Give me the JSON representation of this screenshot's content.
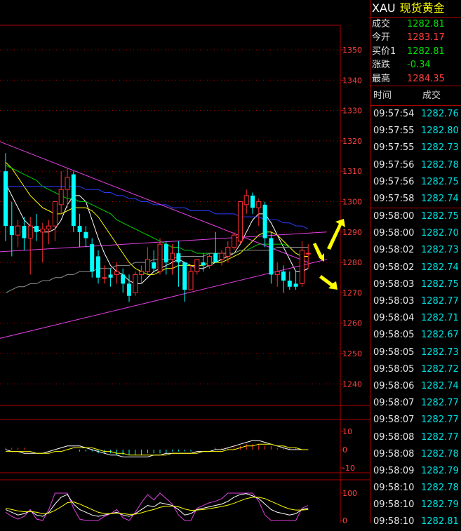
{
  "header": {
    "symbol": "XAU",
    "name": "现货黄金"
  },
  "quote": [
    {
      "label": "成交",
      "value": "1282.81",
      "color": "down"
    },
    {
      "label": "今开",
      "value": "1283.17",
      "color": "up"
    },
    {
      "label": "买价1",
      "value": "1282.81",
      "color": "down"
    },
    {
      "label": "涨跌",
      "value": "-0.34",
      "color": "down"
    },
    {
      "label": "最高",
      "value": "1284.35",
      "color": "up"
    }
  ],
  "ticks_header": {
    "time": "时间",
    "price": "成交"
  },
  "ticks_group1": [
    {
      "time": "09:57:54",
      "price": "1282.76"
    },
    {
      "time": "09:57:55",
      "price": "1282.80"
    },
    {
      "time": "09:57:55",
      "price": "1282.73"
    },
    {
      "time": "09:57:56",
      "price": "1282.78"
    },
    {
      "time": "09:57:56",
      "price": "1282.75"
    },
    {
      "time": "09:57:58",
      "price": "1282.74"
    }
  ],
  "ticks_group2": [
    {
      "time": "09:58:00",
      "price": "1282.75"
    },
    {
      "time": "09:58:00",
      "price": "1282.70"
    },
    {
      "time": "09:58:02",
      "price": "1282.73"
    },
    {
      "time": "09:58:02",
      "price": "1282.74"
    },
    {
      "time": "09:58:03",
      "price": "1282.75"
    },
    {
      "time": "09:58:03",
      "price": "1282.77"
    },
    {
      "time": "09:58:04",
      "price": "1282.71"
    },
    {
      "time": "09:58:05",
      "price": "1282.67"
    },
    {
      "time": "09:58:05",
      "price": "1282.73"
    },
    {
      "time": "09:58:05",
      "price": "1282.72"
    },
    {
      "time": "09:58:06",
      "price": "1282.74"
    },
    {
      "time": "09:58:07",
      "price": "1282.77"
    },
    {
      "time": "09:58:07",
      "price": "1282.77"
    },
    {
      "time": "09:58:08",
      "price": "1282.77"
    },
    {
      "time": "09:58:08",
      "price": "1282.78"
    },
    {
      "time": "09:58:09",
      "price": "1282.79"
    },
    {
      "time": "09:58:10",
      "price": "1282.78"
    },
    {
      "time": "09:58:10",
      "price": "1282.79"
    },
    {
      "time": "09:58:10",
      "price": "1282.81"
    }
  ],
  "colors": {
    "up": "#ff3030",
    "down": "#00ffff",
    "border": "#b00000",
    "axis_text": "#ff4040"
  },
  "chart_data": {
    "type": "candlestick",
    "price_axis": {
      "ylim": [
        1230,
        1360
      ],
      "ticks": [
        1350,
        1340,
        1330,
        1320,
        1310,
        1300,
        1290,
        1280,
        1270,
        1260,
        1250,
        1240
      ]
    },
    "macd_axis": {
      "ticks": [
        10,
        0,
        -10
      ]
    },
    "kdj_axis": {
      "ticks": [
        100,
        0
      ]
    },
    "candles": [
      {
        "o": 1310,
        "h": 1316,
        "l": 1287,
        "c": 1292
      },
      {
        "o": 1292,
        "h": 1300,
        "l": 1282,
        "c": 1289
      },
      {
        "o": 1289,
        "h": 1294,
        "l": 1285,
        "c": 1292
      },
      {
        "o": 1292,
        "h": 1295,
        "l": 1284,
        "c": 1288
      },
      {
        "o": 1288,
        "h": 1295,
        "l": 1276,
        "c": 1292
      },
      {
        "o": 1292,
        "h": 1296,
        "l": 1287,
        "c": 1290
      },
      {
        "o": 1290,
        "h": 1293,
        "l": 1280,
        "c": 1291
      },
      {
        "o": 1291,
        "h": 1294,
        "l": 1286,
        "c": 1292
      },
      {
        "o": 1292,
        "h": 1300,
        "l": 1287,
        "c": 1300
      },
      {
        "o": 1299,
        "h": 1310,
        "l": 1296,
        "c": 1304
      },
      {
        "o": 1304,
        "h": 1311,
        "l": 1298,
        "c": 1308
      },
      {
        "o": 1309,
        "h": 1310,
        "l": 1290,
        "c": 1292
      },
      {
        "o": 1292,
        "h": 1296,
        "l": 1285,
        "c": 1290
      },
      {
        "o": 1290,
        "h": 1292,
        "l": 1285,
        "c": 1288
      },
      {
        "o": 1286,
        "h": 1288,
        "l": 1275,
        "c": 1277
      },
      {
        "o": 1282,
        "h": 1284,
        "l": 1273,
        "c": 1275
      },
      {
        "o": 1275,
        "h": 1279,
        "l": 1273,
        "c": 1275
      },
      {
        "o": 1276,
        "h": 1278,
        "l": 1272,
        "c": 1275
      },
      {
        "o": 1276,
        "h": 1280,
        "l": 1273,
        "c": 1277
      },
      {
        "o": 1276,
        "h": 1278,
        "l": 1270,
        "c": 1273
      },
      {
        "o": 1273,
        "h": 1276,
        "l": 1267,
        "c": 1269
      },
      {
        "o": 1270,
        "h": 1277,
        "l": 1269,
        "c": 1276
      },
      {
        "o": 1276,
        "h": 1279,
        "l": 1273,
        "c": 1277
      },
      {
        "o": 1277,
        "h": 1285,
        "l": 1276,
        "c": 1281
      },
      {
        "o": 1280,
        "h": 1284,
        "l": 1277,
        "c": 1278
      },
      {
        "o": 1277,
        "h": 1288,
        "l": 1276,
        "c": 1286
      },
      {
        "o": 1286,
        "h": 1287,
        "l": 1276,
        "c": 1280
      },
      {
        "o": 1281,
        "h": 1286,
        "l": 1276,
        "c": 1283
      },
      {
        "o": 1283,
        "h": 1287,
        "l": 1272,
        "c": 1280
      },
      {
        "o": 1280,
        "h": 1280,
        "l": 1267,
        "c": 1271
      },
      {
        "o": 1271,
        "h": 1279,
        "l": 1271,
        "c": 1277
      },
      {
        "o": 1277,
        "h": 1281,
        "l": 1276,
        "c": 1281
      },
      {
        "o": 1280,
        "h": 1283,
        "l": 1277,
        "c": 1279
      },
      {
        "o": 1279,
        "h": 1283,
        "l": 1278,
        "c": 1282
      },
      {
        "o": 1283,
        "h": 1290,
        "l": 1280,
        "c": 1280
      },
      {
        "o": 1281,
        "h": 1284,
        "l": 1279,
        "c": 1283
      },
      {
        "o": 1282,
        "h": 1287,
        "l": 1280,
        "c": 1285
      },
      {
        "o": 1285,
        "h": 1290,
        "l": 1284,
        "c": 1289
      },
      {
        "o": 1287,
        "h": 1300,
        "l": 1286,
        "c": 1300
      },
      {
        "o": 1299,
        "h": 1304,
        "l": 1296,
        "c": 1302
      },
      {
        "o": 1302,
        "h": 1303,
        "l": 1296,
        "c": 1298
      },
      {
        "o": 1298,
        "h": 1301,
        "l": 1292,
        "c": 1300
      },
      {
        "o": 1299,
        "h": 1300,
        "l": 1285,
        "c": 1288
      },
      {
        "o": 1288,
        "h": 1290,
        "l": 1273,
        "c": 1276
      },
      {
        "o": 1276,
        "h": 1280,
        "l": 1272,
        "c": 1277
      },
      {
        "o": 1277,
        "h": 1279,
        "l": 1270,
        "c": 1274
      },
      {
        "o": 1274,
        "h": 1277,
        "l": 1271,
        "c": 1272
      },
      {
        "o": 1273,
        "h": 1277,
        "l": 1271,
        "c": 1272
      },
      {
        "o": 1273,
        "h": 1287,
        "l": 1272,
        "c": 1284
      },
      {
        "o": 1283,
        "h": 1286,
        "l": 1278,
        "c": 1283
      }
    ],
    "moving_averages": [
      {
        "color": "#ffffff",
        "values": [
          1306,
          1302,
          1298,
          1294,
          1292,
          1291,
          1290,
          1290,
          1291,
          1294,
          1299,
          1302,
          1302,
          1300,
          1294,
          1288,
          1283,
          1279,
          1277,
          1276,
          1274,
          1273,
          1273,
          1275,
          1277,
          1278,
          1279,
          1280,
          1281,
          1280,
          1279,
          1278,
          1278,
          1279,
          1280,
          1281,
          1282,
          1283,
          1286,
          1290,
          1294,
          1296,
          1296,
          1293,
          1289,
          1285,
          1281,
          1277,
          1277,
          1278
        ]
      },
      {
        "color": "#ffff00",
        "values": [
          1313,
          1311,
          1308,
          1305,
          1302,
          1300,
          1298,
          1297,
          1296,
          1296,
          1297,
          1298,
          1298,
          1298,
          1297,
          1295,
          1292,
          1289,
          1286,
          1283,
          1280,
          1278,
          1277,
          1276,
          1276,
          1277,
          1278,
          1278,
          1279,
          1279,
          1279,
          1279,
          1279,
          1280,
          1280,
          1280,
          1281,
          1282,
          1283,
          1285,
          1287,
          1289,
          1290,
          1290,
          1289,
          1287,
          1285,
          1283,
          1282,
          1282
        ]
      },
      {
        "color": "#00d000",
        "values": [
          1312,
          1311,
          1310,
          1309,
          1308,
          1307,
          1305,
          1304,
          1303,
          1302,
          1301,
          1301,
          1300,
          1300,
          1299,
          1298,
          1297,
          1296,
          1294,
          1293,
          1292,
          1291,
          1290,
          1289,
          1288,
          1287,
          1286,
          1285,
          1285,
          1284,
          1284,
          1283,
          1283,
          1283,
          1283,
          1283,
          1283,
          1283,
          1284,
          1284,
          1285,
          1286,
          1286,
          1286,
          1286,
          1286,
          1285,
          1285,
          1285,
          1285
        ]
      },
      {
        "color": "#2a3cff",
        "values": [
          1305,
          1305,
          1305,
          1305,
          1305,
          1305,
          1305,
          1305,
          1305,
          1305,
          1305,
          1305,
          1305,
          1304,
          1304,
          1304,
          1303,
          1303,
          1302,
          1302,
          1301,
          1301,
          1300,
          1300,
          1299,
          1299,
          1299,
          1298,
          1298,
          1298,
          1297,
          1297,
          1297,
          1297,
          1296,
          1296,
          1296,
          1296,
          1295,
          1295,
          1295,
          1295,
          1294,
          1294,
          1294,
          1293,
          1293,
          1292,
          1292,
          1291
        ]
      },
      {
        "color": "#909090",
        "values": [
          1270,
          1271,
          1272,
          1272,
          1273,
          1273,
          1274,
          1274,
          1275,
          1275,
          1276,
          1276,
          1277,
          1277,
          1277,
          1278,
          1278,
          1278,
          1279,
          1279,
          1279,
          1280,
          1280,
          1280,
          1281,
          1281,
          1281,
          1281,
          1282,
          1282,
          1282,
          1282,
          1282,
          1283,
          1283,
          1283,
          1283,
          1283,
          1284,
          1284,
          1284,
          1284,
          1284,
          1284,
          1285,
          1285,
          1285,
          1285,
          1285,
          1285
        ]
      }
    ],
    "trend_lines": [
      {
        "from": [
          -5,
          1323
        ],
        "to": [
          49,
          1280
        ]
      },
      {
        "from": [
          -5,
          1253
        ],
        "to": [
          52,
          1281
        ]
      },
      {
        "from": [
          -5,
          1283
        ],
        "to": [
          52,
          1290
        ]
      }
    ],
    "macd_values": [
      1,
      1,
      1,
      1,
      0,
      0,
      0,
      0,
      0,
      0,
      0,
      0,
      -1,
      -1,
      -1,
      -2,
      -2,
      -2,
      -3,
      -3,
      -3,
      -3,
      -3,
      -2,
      -2,
      -2,
      -2,
      -1,
      -1,
      -1,
      -1,
      0,
      0,
      0,
      1,
      1,
      1,
      2,
      2,
      3,
      3,
      3,
      2,
      2,
      1,
      1,
      1,
      1,
      0,
      0
    ],
    "macd_line_a": [
      0,
      -1,
      -1,
      -2,
      -2,
      -2,
      -2,
      -1,
      0,
      1,
      2,
      2,
      2,
      1,
      0,
      -1,
      -2,
      -3,
      -3,
      -4,
      -4,
      -4,
      -4,
      -4,
      -3,
      -3,
      -2,
      -2,
      -2,
      -2,
      -2,
      -1,
      -1,
      -1,
      0,
      0,
      1,
      2,
      3,
      4,
      5,
      5,
      4,
      3,
      2,
      1,
      0,
      0,
      0,
      0
    ],
    "macd_line_b": [
      -1,
      -1,
      -1,
      -1,
      -1,
      -2,
      -2,
      -2,
      -1,
      -1,
      0,
      1,
      1,
      1,
      1,
      0,
      -1,
      -1,
      -2,
      -2,
      -3,
      -3,
      -3,
      -3,
      -3,
      -3,
      -3,
      -2,
      -2,
      -2,
      -2,
      -2,
      -1,
      -1,
      -1,
      -1,
      0,
      0,
      1,
      2,
      2,
      3,
      3,
      3,
      2,
      2,
      1,
      1,
      0,
      0
    ],
    "kdj_k": [
      40,
      30,
      20,
      25,
      35,
      20,
      15,
      30,
      60,
      85,
      95,
      60,
      40,
      30,
      20,
      15,
      20,
      25,
      30,
      20,
      15,
      25,
      40,
      55,
      50,
      65,
      60,
      55,
      40,
      20,
      25,
      40,
      45,
      50,
      55,
      60,
      70,
      85,
      95,
      98,
      90,
      80,
      60,
      40,
      30,
      25,
      20,
      25,
      40,
      45
    ],
    "kdj_d": [
      45,
      40,
      35,
      32,
      33,
      30,
      25,
      27,
      37,
      50,
      65,
      68,
      60,
      50,
      40,
      30,
      25,
      25,
      27,
      25,
      22,
      23,
      28,
      35,
      40,
      48,
      52,
      53,
      50,
      42,
      37,
      38,
      40,
      43,
      47,
      51,
      56,
      63,
      72,
      80,
      85,
      85,
      80,
      70,
      60,
      50,
      42,
      38,
      38,
      40
    ],
    "kdj_j": [
      30,
      15,
      5,
      15,
      40,
      5,
      0,
      40,
      100,
      100,
      100,
      45,
      5,
      0,
      0,
      0,
      15,
      25,
      40,
      10,
      0,
      30,
      65,
      95,
      75,
      100,
      80,
      60,
      20,
      0,
      0,
      45,
      55,
      65,
      70,
      80,
      100,
      100,
      100,
      100,
      100,
      70,
      20,
      0,
      0,
      0,
      0,
      0,
      45,
      55
    ]
  }
}
